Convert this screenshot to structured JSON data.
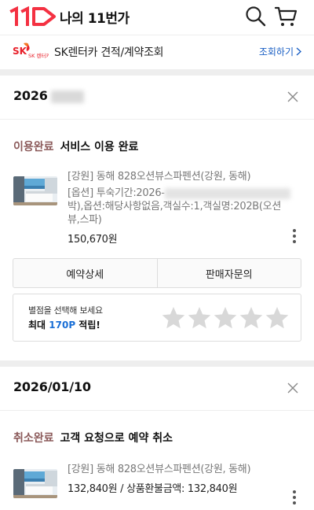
{
  "header": {
    "logo_text": "11번가",
    "title": "나의 11번가",
    "icons": [
      "search-icon",
      "cart-icon"
    ]
  },
  "banner": {
    "logo_text": "SK 렌터카",
    "text": "SK렌터카 견적/계약조회",
    "link": "조회하기"
  },
  "orders": [
    {
      "date": "2026",
      "status_label": "이용완료",
      "status_text": "서비스 이용 완료",
      "item_title": "[강원] 동해 828오션뷰스파펜션(강원, 동해)",
      "option_prefix": "[옵션] 투숙기간:2026-",
      "option_rest": "박),옵션:해당사항없음,객실수:1,객실명:202B(오션뷰,스파)",
      "price": "150,670원",
      "buttons": [
        "예약상세",
        "판매자문의"
      ],
      "rating": {
        "hint": "별점을 선택해 보세요",
        "points_prefix": "최대 ",
        "points_value": "170P",
        "points_suffix": " 적립!",
        "max_stars": 5,
        "selected": 0
      }
    },
    {
      "date": "2026/01/10",
      "status_label": "취소완료",
      "status_text": "고객 요청으로 예약 취소",
      "item_title": "[강원] 동해 828오션뷰스파펜션(강원, 동해)",
      "price": "132,840원 / 상품환불금액: 132,840원"
    }
  ],
  "colors": {
    "brand_red": "#f43142",
    "status_label": "#8b5a5a",
    "link_blue": "#1a5fc4",
    "points_blue": "#1a6fd6",
    "star_gray": "#d8d8d8"
  }
}
